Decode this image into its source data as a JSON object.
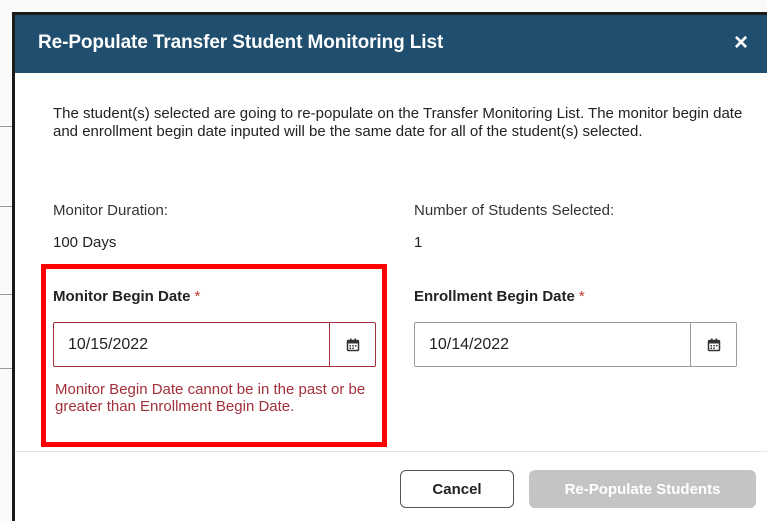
{
  "dialog": {
    "title": "Re-Populate Transfer Student Monitoring List",
    "close_label": "×",
    "description": "The student(s) selected are going to re-populate on the Transfer Monitoring List. The monitor begin date and enrollment begin date inputed will be the same date for all of the student(s) selected."
  },
  "info": {
    "monitor_duration_label": "Monitor Duration:",
    "monitor_duration_value": "100 Days",
    "students_selected_label": "Number of Students Selected:",
    "students_selected_value": "1"
  },
  "monitor_begin": {
    "label": "Monitor Begin Date",
    "required_mark": "*",
    "value": "10/15/2022",
    "calendar_icon": "calendar-icon",
    "error": "Monitor Begin Date cannot be in the past or be greater than Enrollment Begin Date."
  },
  "enrollment_begin": {
    "label": "Enrollment Begin Date",
    "required_mark": "*",
    "value": "10/14/2022",
    "calendar_icon": "calendar-icon"
  },
  "footer": {
    "cancel_label": "Cancel",
    "submit_label": "Re-Populate Students"
  },
  "colors": {
    "header_bg": "#1f4e6e",
    "error": "#a2303a",
    "highlight": "#ff0000",
    "required": "#c0392b",
    "disabled_button": "#c4c4c4"
  }
}
